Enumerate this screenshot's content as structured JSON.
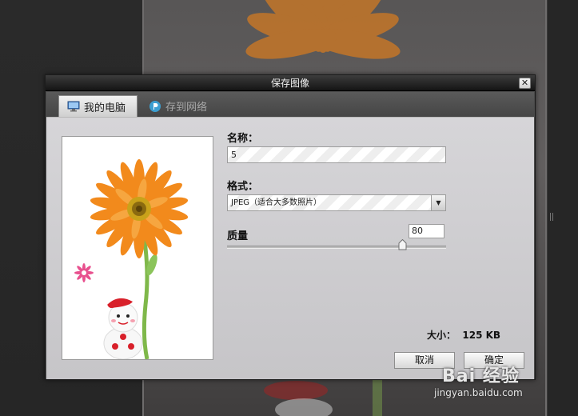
{
  "dialog": {
    "title": "保存图像",
    "close_symbol": "✕",
    "tabs": [
      {
        "label": "我的电脑",
        "icon": "monitor-icon",
        "active": true
      },
      {
        "label": "存到网络",
        "icon": "cloud-icon",
        "active": false
      }
    ],
    "name_field": {
      "label": "名称：",
      "value": "5"
    },
    "format_field": {
      "label": "格式：",
      "value": "JPEG（适合大多数照片）"
    },
    "quality_field": {
      "label": "质量",
      "value": "80"
    },
    "size": {
      "label": "大小：",
      "value": "125 KB"
    },
    "buttons": {
      "cancel": "取消",
      "confirm": "确定"
    }
  },
  "watermark": {
    "brand": "Bai 经验",
    "url": "jingyan.baidu.com"
  },
  "colors": {
    "dialog_body": "#c9c8cb",
    "titlebar": "#1a1a1a",
    "flower_orange": "#f28a1c",
    "background": "#1e1e1e"
  }
}
